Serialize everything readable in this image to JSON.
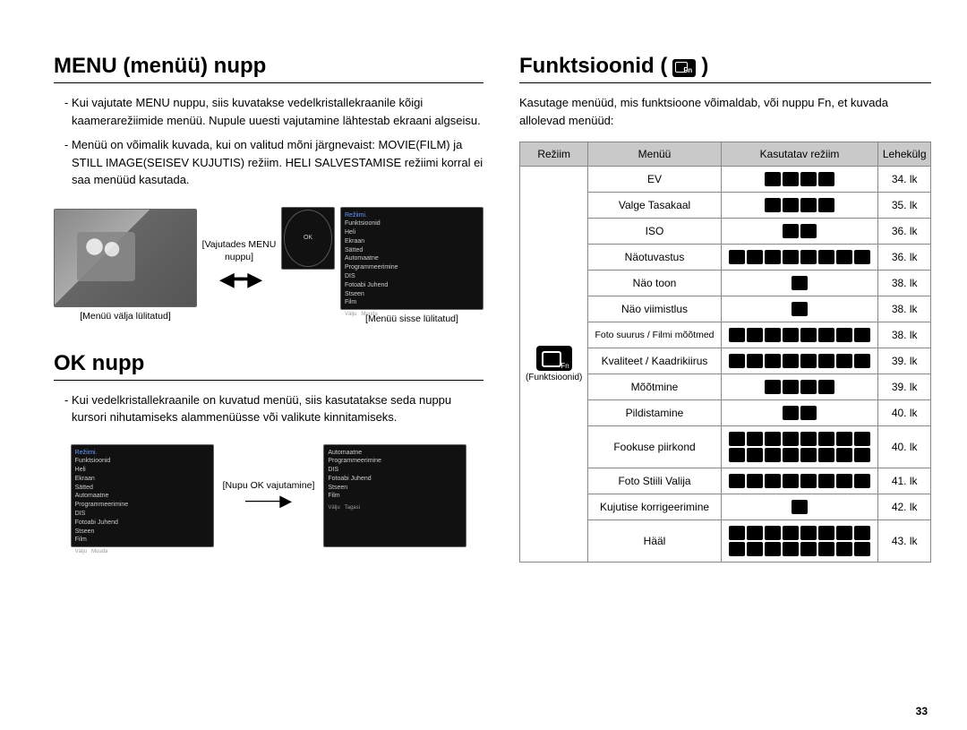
{
  "left": {
    "section1_title": "MENU (menüü) nupp",
    "s1_p1": "- Kui vajutate MENU nuppu, siis kuvatakse vedelkristallekraanile kõigi kaamerarežiimide menüü. Nupule uuesti vajutamine lähtestab ekraani algseisu.",
    "s1_p2": "- Menüü on võimalik kuvada, kui on valitud mõni järgnevaist: MOVIE(FILM) ja STILL IMAGE(SEISEV KUJUTIS) režiim. HELI SALVESTAMISE režiimi korral ei saa menüüd kasutada.",
    "fig1_cap_left": "[Menüü välja lülitatud]",
    "fig1_mid_label": "[Vajutades MENU nuppu]",
    "fig1_cap_right": "[Menüü sisse lülitatud]",
    "section2_title": "OK nupp",
    "s2_p1": "- Kui vedelkristallekraanile on kuvatud menüü, siis kasutatakse seda nuppu kursori nihutamiseks alammenüüsse või valikute kinnitamiseks.",
    "fig2_mid_label": "[Nupu OK vajutamine]",
    "menu_items": {
      "head": "Režiimi.",
      "l1": "Funktsioonid",
      "l2": "Heli",
      "l3": "Ekraan",
      "l4": "Sätted",
      "r1": "Automaatne",
      "r2": "Programmeerimine",
      "r3": "DIS",
      "r4": "Fotoabi Juhend",
      "r5": "Stseen",
      "r6": "Film",
      "foot_exit": "Välju",
      "foot_change": "Muuda",
      "foot_back": "Tagasi"
    }
  },
  "right": {
    "section_title": "Funktsioonid (",
    "intro": "Kasutage menüüd, mis funktsioone võimaldab, või nuppu Fn, et kuvada allolevad menüüd:",
    "headers": {
      "mode": "Režiim",
      "menu": "Menüü",
      "usable": "Kasutatav režiim",
      "page": "Lehekülg"
    },
    "mode_label": "(Funktsioonid)",
    "rows": [
      {
        "menu": "EV",
        "icons": 4,
        "page": "34. lk"
      },
      {
        "menu": "Valge Tasakaal",
        "icons": 4,
        "page": "35. lk"
      },
      {
        "menu": "ISO",
        "icons": 2,
        "page": "36. lk"
      },
      {
        "menu": "Näotuvastus",
        "icons": 8,
        "page": "36. lk"
      },
      {
        "menu": "Näo toon",
        "icons": 1,
        "page": "38. lk"
      },
      {
        "menu": "Näo viimistlus",
        "icons": 1,
        "page": "38. lk"
      },
      {
        "menu": "Foto suurus / Filmi mõõtmed",
        "icons": 8,
        "page": "38. lk"
      },
      {
        "menu": "Kvaliteet / Kaadrikiirus",
        "icons": 8,
        "page": "39. lk"
      },
      {
        "menu": "Mõõtmine",
        "icons": 4,
        "page": "39. lk"
      },
      {
        "menu": "Pildistamine",
        "icons": 2,
        "page": "40. lk"
      },
      {
        "menu": "Fookuse piirkond",
        "icons": 16,
        "page": "40. lk"
      },
      {
        "menu": "Foto Stiili Valija",
        "icons": 8,
        "page": "41. lk"
      },
      {
        "menu": "Kujutise korrigeerimine",
        "icons": 1,
        "page": "42. lk"
      },
      {
        "menu": "Hääl",
        "icons": 16,
        "page": "43. lk"
      }
    ]
  },
  "page_number": "33"
}
